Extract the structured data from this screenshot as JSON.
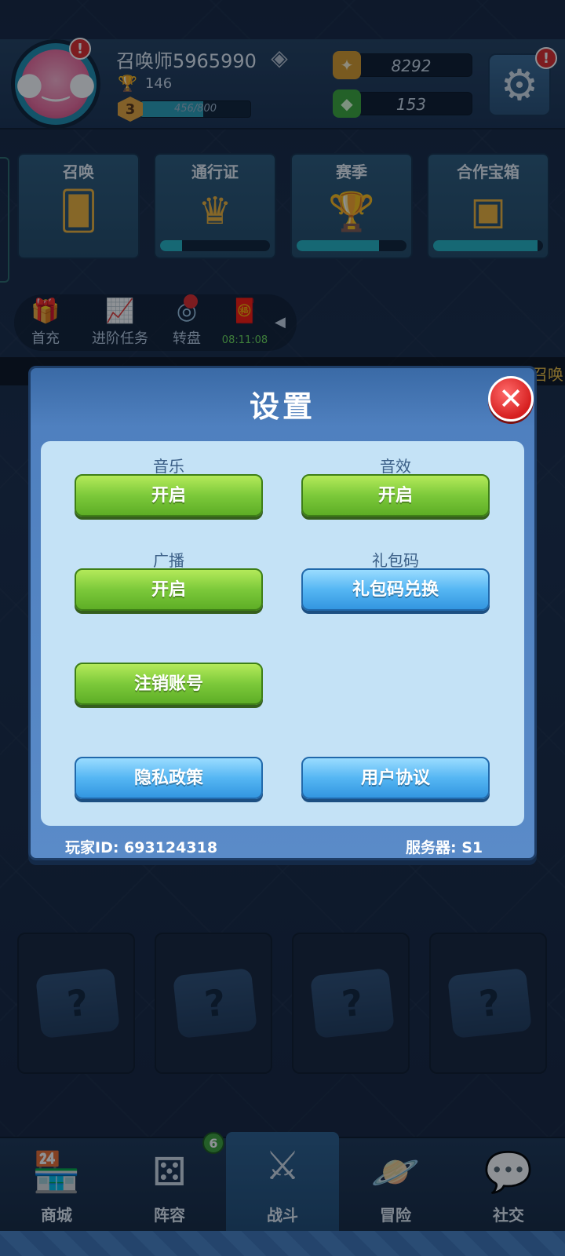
{
  "header": {
    "player_name": "召唤师5965990",
    "trophies": "146",
    "level": "3",
    "xp_text": "456/800",
    "xp_progress": 0.57,
    "gold": "8292",
    "gems": "153",
    "notif_mark": "!"
  },
  "features": [
    {
      "title": "召唤",
      "icon": "card-icon"
    },
    {
      "title": "通行证",
      "icon": "crown-badge-icon",
      "progress": 0.2
    },
    {
      "title": "赛季",
      "icon": "trophy-icon",
      "progress": 0.75
    },
    {
      "title": "合作宝箱",
      "icon": "chest-icon",
      "progress": 0.95
    }
  ],
  "activities": [
    {
      "label": "首充",
      "icon": "gift-icon"
    },
    {
      "label": "进阶任务",
      "icon": "chart-up-icon"
    },
    {
      "label": "转盘",
      "icon": "wheel-icon"
    },
    {
      "label": "08:11:08",
      "icon": "red-packet-icon"
    }
  ],
  "ticker": {
    "text": "召唤"
  },
  "dialog": {
    "title": "设置",
    "close_glyph": "✕",
    "music_label": "音乐",
    "music_value": "开启",
    "sfx_label": "音效",
    "sfx_value": "开启",
    "broadcast_label": "广播",
    "broadcast_value": "开启",
    "giftcode_label": "礼包码",
    "giftcode_button": "礼包码兑换",
    "logout_button": "注销账号",
    "privacy_button": "隐私政策",
    "agreement_button": "用户协议",
    "player_id": "玩家ID: 693124318",
    "server": "服务器: S1"
  },
  "mystery_glyph": "?",
  "bottom_nav": {
    "items": [
      {
        "label": "商城",
        "icon": "shop-icon"
      },
      {
        "label": "阵容",
        "icon": "dice-icon",
        "badge": "6"
      },
      {
        "label": "战斗",
        "icon": "crossed-swords-icon"
      },
      {
        "label": "冒险",
        "icon": "planet-icon"
      },
      {
        "label": "社交",
        "icon": "chat-icon"
      }
    ]
  },
  "colors": {
    "accent_green": "#7cc93a",
    "accent_blue": "#55b6f3",
    "close_red": "#d61f1f",
    "dialog_body": "#c4e2f6"
  }
}
